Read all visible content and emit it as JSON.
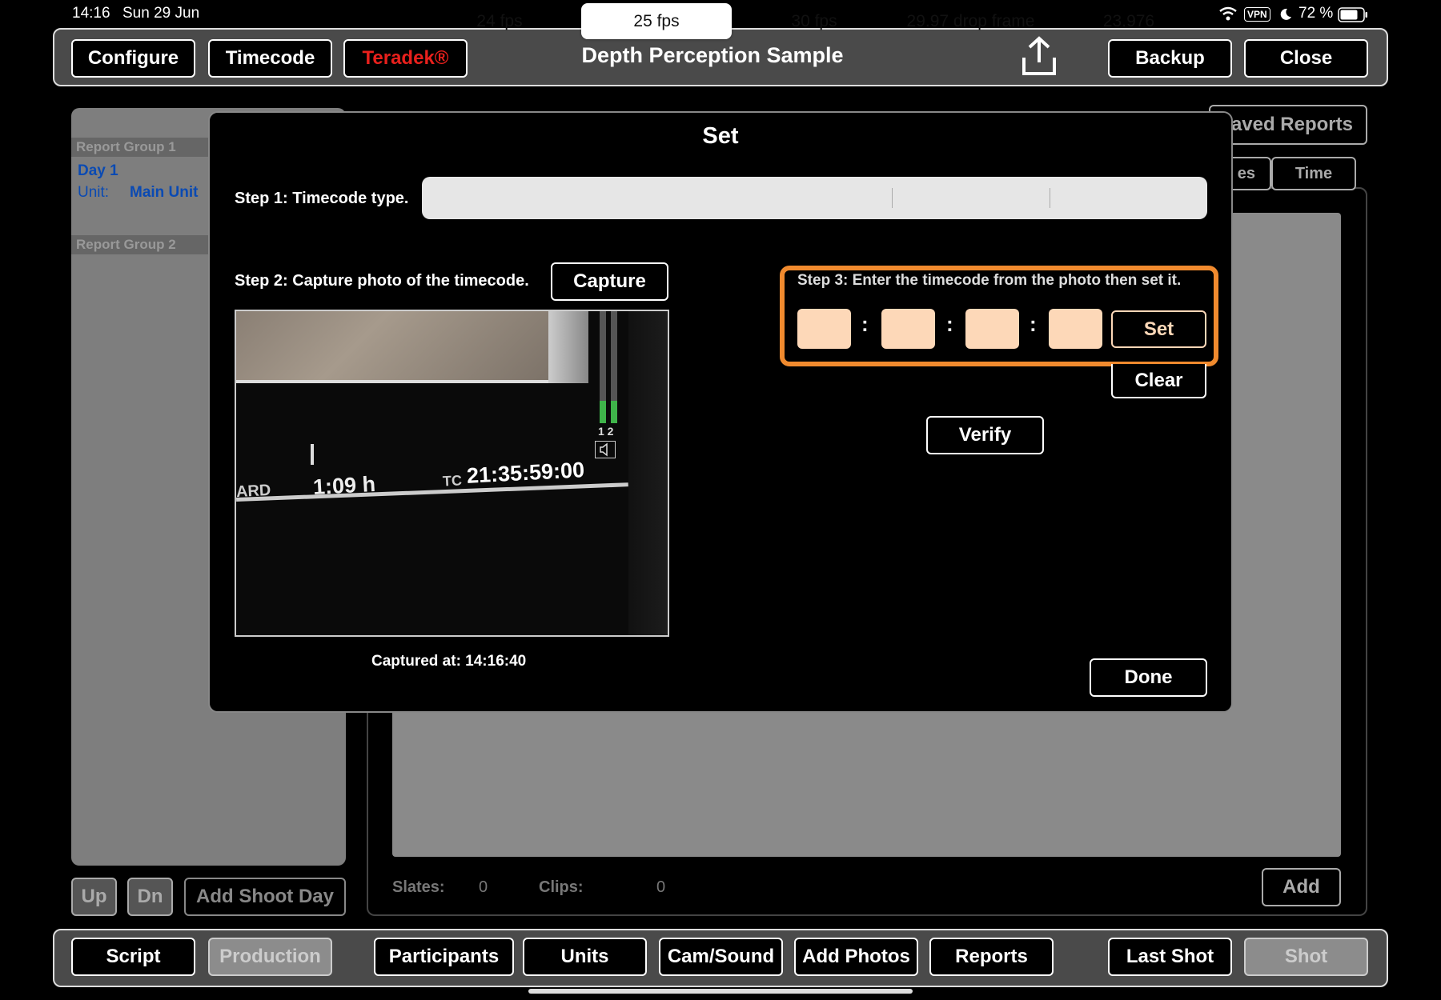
{
  "status": {
    "time": "14:16",
    "date": "Sun 29 Jun",
    "vpn": "VPN",
    "battery": "72 %"
  },
  "topbar": {
    "configure": "Configure",
    "timecode": "Timecode",
    "teradek": "Teradek®",
    "title": "Depth Perception Sample",
    "backup": "Backup",
    "close": "Close"
  },
  "sidebar": {
    "group1": "Report Group 1",
    "day": "Day 1",
    "unit_label": "Unit:",
    "unit_value": "Main Unit",
    "group2": "Report Group 2",
    "up": "Up",
    "dn": "Dn",
    "add_shoot_day": "Add Shoot Day"
  },
  "main": {
    "saved_reports": "aved Reports",
    "tab_partial": "es",
    "tab_time": "Time",
    "slates_label": "Slates:",
    "slates_value": "0",
    "clips_label": "Clips:",
    "clips_value": "0",
    "add": "Add"
  },
  "modal": {
    "title": "Set",
    "step1": "Step 1: Timecode type.",
    "fps_options": [
      "24 fps",
      "25 fps",
      "30 fps",
      "29.97 drop frame",
      "23.976"
    ],
    "fps_selected": "25 fps",
    "step2": "Step 2: Capture photo of the timecode.",
    "capture": "Capture",
    "step3": "Step 3: Enter the timecode from the photo then set it.",
    "tc_separator": ":",
    "set": "Set",
    "clear": "Clear",
    "verify": "Verify",
    "captured_at": "Captured at: 14:16:40",
    "done": "Done",
    "photo": {
      "duration": "1:09 h",
      "tc_prefix": "TC",
      "timecode": "21:35:59:00",
      "edge_text": "ARD",
      "channels": "1 2"
    }
  },
  "bottombar": {
    "script": "Script",
    "production": "Production",
    "participants": "Participants",
    "units": "Units",
    "cam_sound": "Cam/Sound",
    "add_photos": "Add Photos",
    "reports": "Reports",
    "last_shot": "Last Shot",
    "shot": "Shot"
  },
  "colors": {
    "accent_orange": "#f08a2e",
    "teradek_red": "#e8201c",
    "field_peach": "#fdd8b8"
  }
}
